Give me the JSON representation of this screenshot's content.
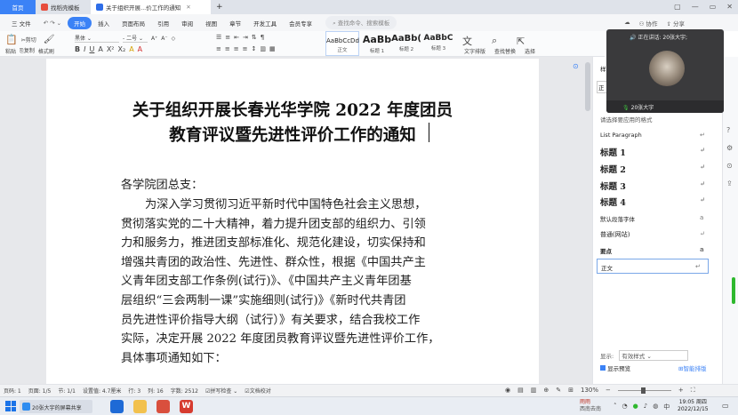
{
  "tabs": [
    {
      "label": "首页"
    },
    {
      "label": "找稻壳模板"
    },
    {
      "label": "关于组织开展...价工作的通知"
    }
  ],
  "tab_add": "+",
  "menu": [
    "三 文件",
    "开始",
    "插入",
    "页面布局",
    "引用",
    "审阅",
    "视图",
    "章节",
    "开发工具",
    "会员专享"
  ],
  "menu_active": "开始",
  "search_placeholder": "查找命令、搜索模板",
  "menu_right": [
    "协作",
    "分享"
  ],
  "ribbon": {
    "clipboard": [
      "剪切",
      "复制",
      "格式刷",
      "粘贴"
    ],
    "font_name": "黑体",
    "font_size": "二号",
    "styles": [
      {
        "preview": "AaBbCcDd",
        "name": "正文"
      },
      {
        "preview": "AaBb",
        "name": "标题 1"
      },
      {
        "preview": "AaBb(",
        "name": "标题 2"
      },
      {
        "preview": "AaBbC",
        "name": "标题 3"
      }
    ],
    "tools": [
      "文字排版",
      "查找替换",
      "选择"
    ]
  },
  "document": {
    "title_line1": "关于组织开展长春光华学院 2022 年度团员",
    "title_line2": "教育评议暨先进性评价工作的通知",
    "greeting": "各学院团总支：",
    "body_lines": [
      "为深入学习贯彻习近平新时代中国特色社会主义思想，",
      "贯彻落实党的二十大精神，着力提升团支部的组织力、引领",
      "力和服务力，推进团支部标准化、规范化建设，切实保持和",
      "增强共青团的政治性、先进性、群众性，根据《中国共产主",
      "义青年团支部工作条例(试行)》、《中国共产主义青年团基",
      "层组织“三会两制一课”实施细则(试行)》《新时代共青团",
      "员先进性评价指导大纲（试行）》有关要求，结合我校工作",
      "实际，决定开展 2022 年度团员教育评议暨先进性评价工作，",
      "具体事项通知如下："
    ]
  },
  "style_panel": {
    "title": "样式",
    "current": "正",
    "hint": "请选择要应用的格式",
    "items": [
      {
        "label": "List Paragraph",
        "kind": "normal"
      },
      {
        "label": "标题  1",
        "kind": "heading"
      },
      {
        "label": "标题  2",
        "kind": "heading"
      },
      {
        "label": "标题  3",
        "kind": "heading"
      },
      {
        "label": "标题  4",
        "kind": "heading"
      },
      {
        "label": "默认段落字体",
        "kind": "normal"
      },
      {
        "label": "普通(网站)",
        "kind": "serif"
      },
      {
        "label": "要点",
        "kind": "bold"
      },
      {
        "label": "正文",
        "kind": "selected"
      }
    ],
    "display_label": "显示:",
    "display_value": "有效样式",
    "preview_label": "显示预览",
    "smart_label": "智能排版"
  },
  "video": {
    "speaking": "正在讲话: 20张大宇;",
    "name": "20张大宇"
  },
  "status": {
    "page_num": "页码: 1",
    "page": "页面: 1/5",
    "section": "节: 1/1",
    "setting": "设置值: 4.7厘米",
    "row": "行: 3",
    "col": "列: 16",
    "words": "字数: 2512",
    "spell": "拼写检查",
    "proof": "文档校对",
    "zoom": "130%"
  },
  "taskbar": {
    "app_label": "20张大宇的屏幕共享",
    "weather": "雨雨",
    "weather_sub": "西南去南",
    "time": "19:05 周四",
    "date": "2022/12/15",
    "ime": "中"
  }
}
